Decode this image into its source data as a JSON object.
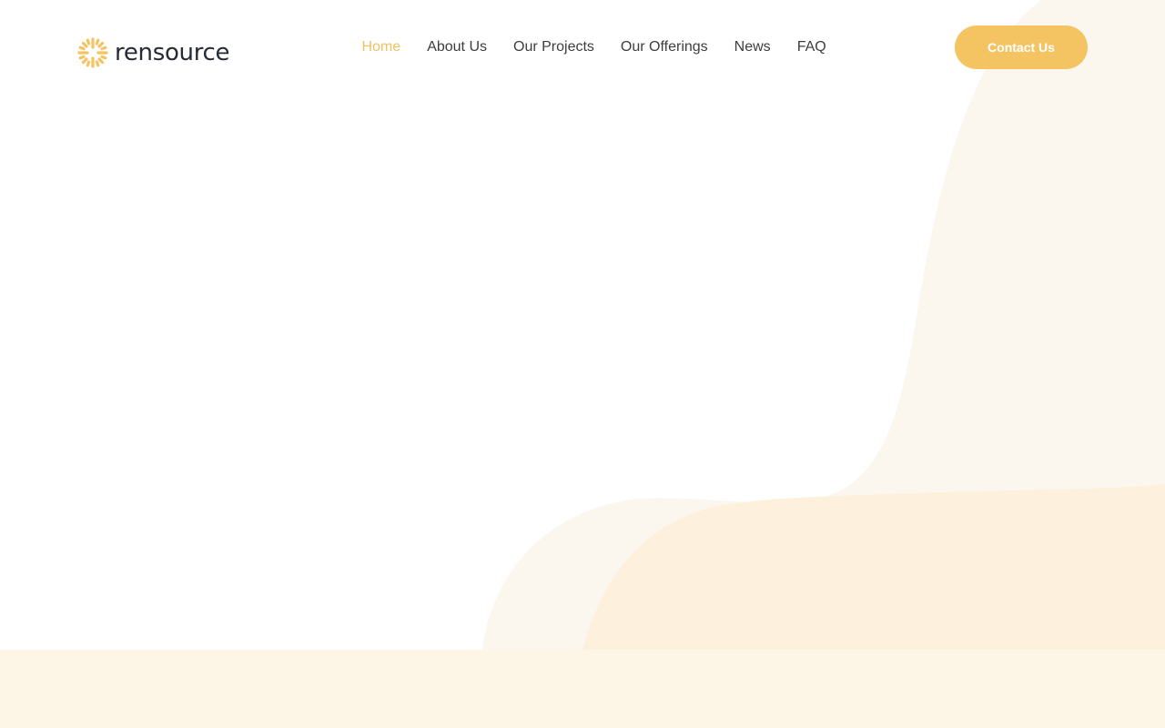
{
  "brand": {
    "name": "rensource",
    "logo_icon": "sunburst-icon",
    "accent_color": "#F5C462",
    "text_color": "#262B36"
  },
  "nav": {
    "items": [
      {
        "label": "Home",
        "active": true
      },
      {
        "label": "About Us",
        "active": false
      },
      {
        "label": "Our Projects",
        "active": false
      },
      {
        "label": "Our Offerings",
        "active": false
      },
      {
        "label": "News",
        "active": false
      },
      {
        "label": "FAQ",
        "active": false
      }
    ],
    "active_color": "#F4C064"
  },
  "header": {
    "contact_label": "Contact Us"
  },
  "theme": {
    "blob_light": "#FCF7EE",
    "blob_warm": "#FDF0DC",
    "band": "#FDF5E6"
  }
}
